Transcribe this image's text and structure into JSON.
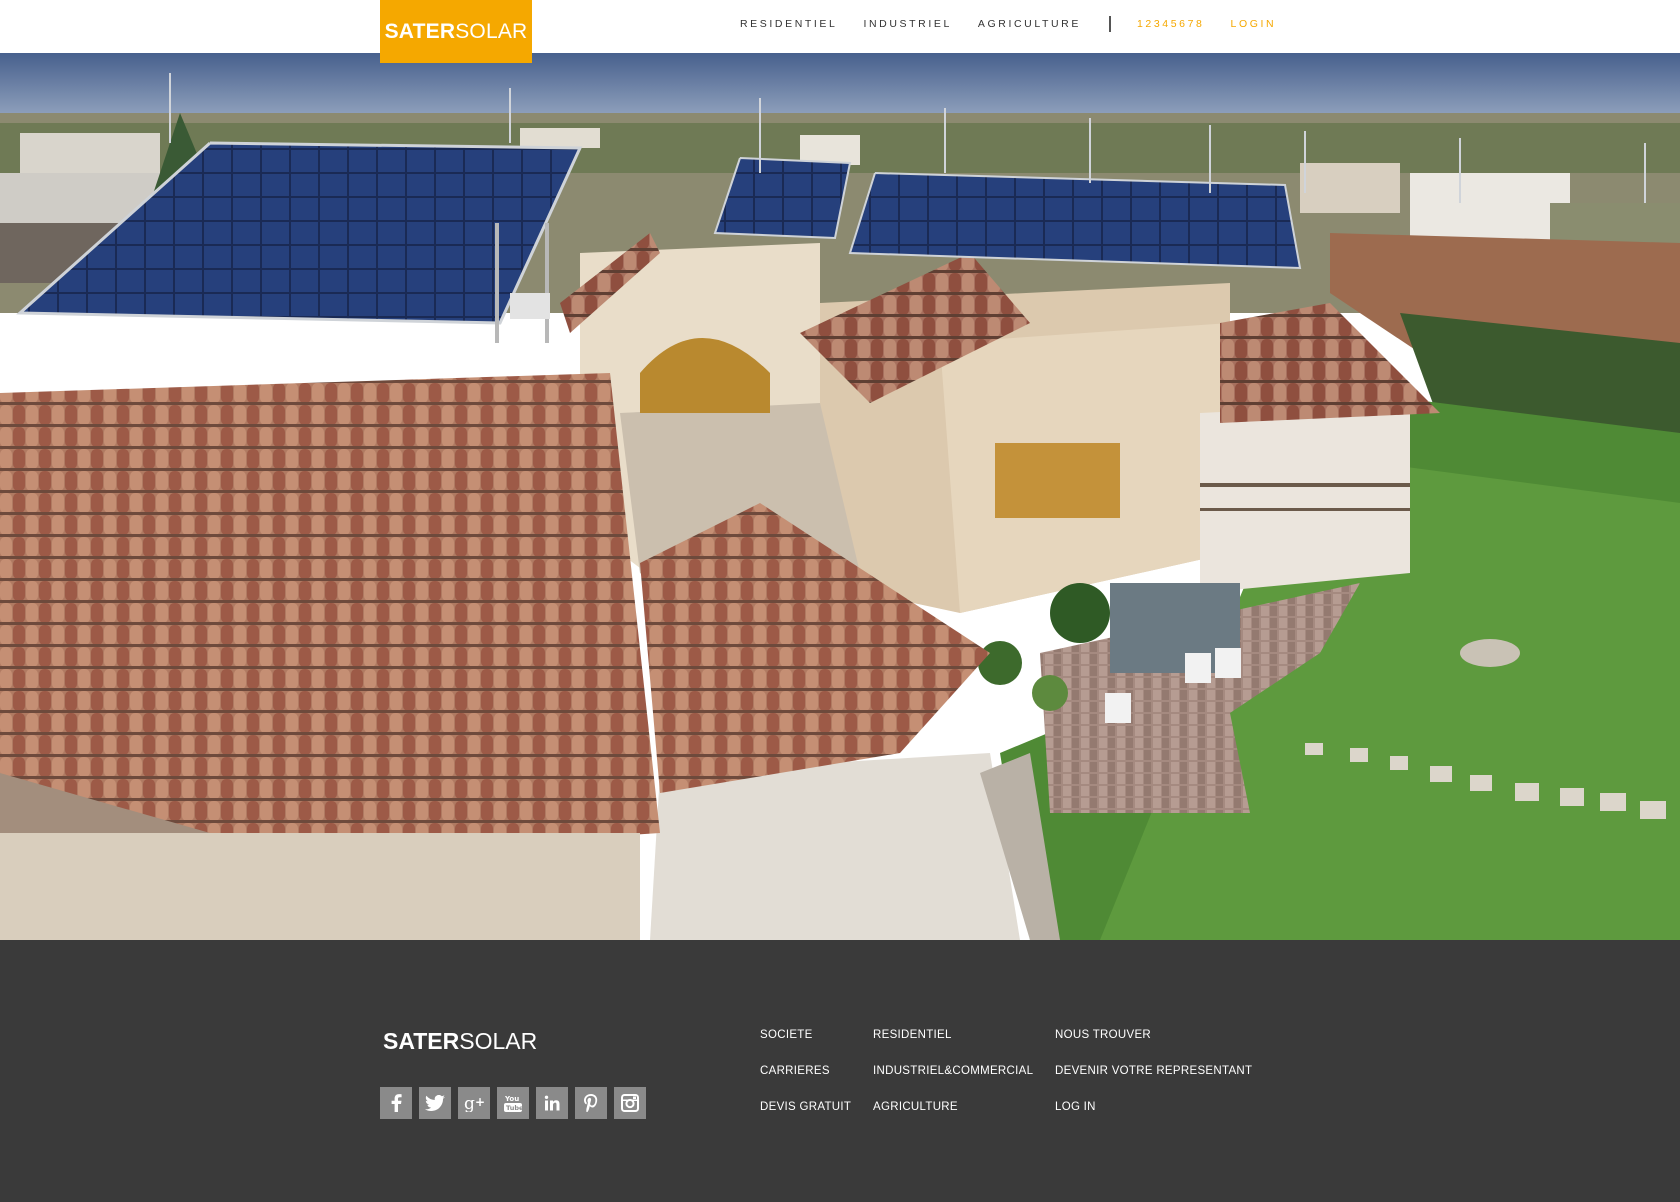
{
  "header": {
    "logo": {
      "bold": "SATER",
      "light": "SOLAR"
    },
    "nav": [
      {
        "label": "RESIDENTIEL"
      },
      {
        "label": "INDUSTRIEL"
      },
      {
        "label": "AGRICULTURE"
      }
    ],
    "phone": "12345678",
    "login": "LOGIN"
  },
  "hero": {
    "image": "house-with-solar-panels-photo"
  },
  "footer": {
    "logo": {
      "bold": "SATER",
      "light": "SOLAR"
    },
    "social": [
      {
        "icon": "facebook-icon"
      },
      {
        "icon": "twitter-icon"
      },
      {
        "icon": "google-plus-icon"
      },
      {
        "icon": "youtube-icon"
      },
      {
        "icon": "linkedin-icon"
      },
      {
        "icon": "pinterest-icon"
      },
      {
        "icon": "instagram-icon"
      }
    ],
    "columns": [
      {
        "links": [
          "SOCIETE",
          "CARRIERES",
          "DEVIS GRATUIT"
        ]
      },
      {
        "links": [
          "RESIDENTIEL",
          "INDUSTRIEL&COMMERCIAL",
          "AGRICULTURE"
        ]
      },
      {
        "links": [
          "NOUS TROUVER",
          "DEVENIR VOTRE REPRESENTANT",
          "LOG IN"
        ]
      }
    ]
  },
  "colors": {
    "accent": "#f5a800",
    "footer_bg": "#3a3a3a",
    "social_bg": "#8a8a8a"
  }
}
